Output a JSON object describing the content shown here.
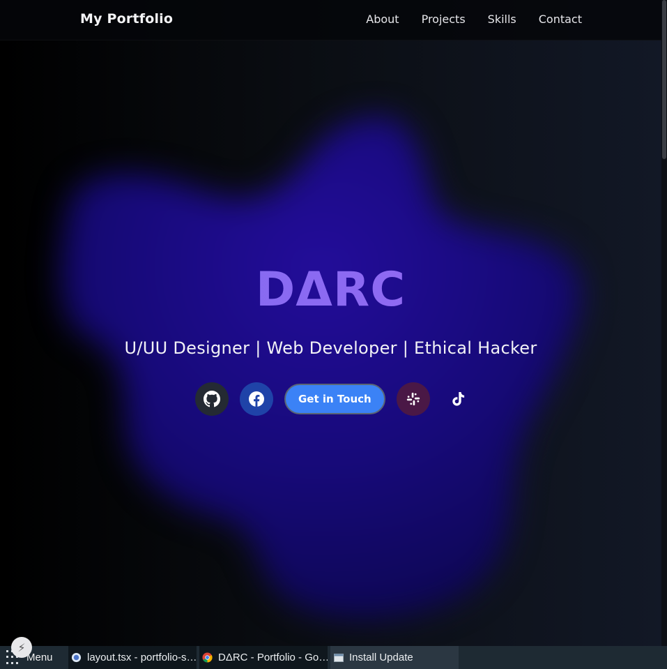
{
  "navbar": {
    "brand": "My Portfolio",
    "links": [
      "About",
      "Projects",
      "Skills",
      "Contact"
    ]
  },
  "hero": {
    "title": "DΔRC",
    "subtitle": "U/UU Designer | Web Developer | Ethical Hacker",
    "cta_label": "Get in Touch",
    "social_icons": [
      "github-icon",
      "facebook-icon",
      "slack-icon",
      "tiktok-icon"
    ]
  },
  "taskbar": {
    "menu_label": "Menu",
    "items": [
      {
        "label": "layout.tsx - portfolio-s…",
        "icon": "vscode-icon"
      },
      {
        "label": "DΔRC - Portfolio - Go…",
        "icon": "chrome-icon"
      },
      {
        "label": "Install Update",
        "icon": "window-icon"
      }
    ]
  },
  "colors": {
    "accent_blue": "#3b82f6",
    "title_gradient_start": "#7c6cf0",
    "title_gradient_end": "#b07cf6",
    "blob": "#1c0c8e"
  }
}
